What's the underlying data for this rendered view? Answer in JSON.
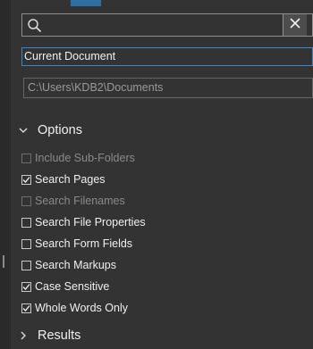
{
  "search": {
    "value": "",
    "placeholder": ""
  },
  "scope": {
    "selected": "Current Document"
  },
  "path": {
    "value": "C:\\Users\\KDB2\\Documents"
  },
  "options": {
    "header": "Options",
    "items": [
      {
        "label": "Include Sub-Folders",
        "checked": false,
        "enabled": false
      },
      {
        "label": "Search Pages",
        "checked": true,
        "enabled": true
      },
      {
        "label": "Search Filenames",
        "checked": false,
        "enabled": false
      },
      {
        "label": "Search File Properties",
        "checked": false,
        "enabled": true
      },
      {
        "label": "Search Form Fields",
        "checked": false,
        "enabled": true
      },
      {
        "label": "Search Markups",
        "checked": false,
        "enabled": true
      },
      {
        "label": "Case Sensitive",
        "checked": true,
        "enabled": true
      },
      {
        "label": "Whole Words Only",
        "checked": true,
        "enabled": true
      }
    ]
  },
  "results": {
    "header": "Results"
  },
  "colors": {
    "background": "#333333",
    "accent_blue": "#3d86c6",
    "tab_blue": "#2f6fa3",
    "text": "#f0f0f0",
    "disabled_text": "#8a8a8a"
  },
  "icons": {
    "search": "search-icon",
    "clear": "close-icon",
    "options_chevron": "chevron-down-icon",
    "results_chevron": "chevron-right-icon",
    "check": "checkmark-icon"
  }
}
